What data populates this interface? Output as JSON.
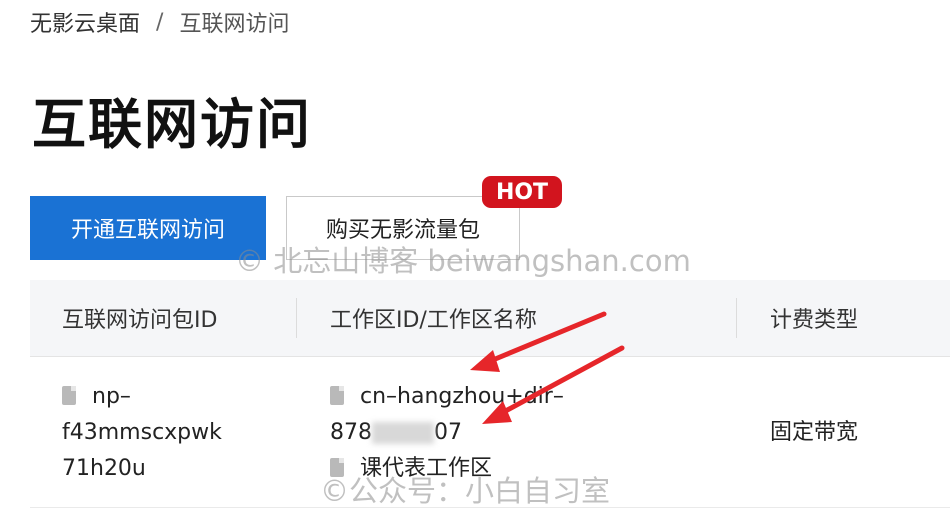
{
  "breadcrumb": {
    "root": "无影云桌面",
    "separator": "/",
    "current": "互联网访问"
  },
  "page": {
    "title": "互联网访问"
  },
  "actions": {
    "enable_label": "开通互联网访问",
    "buy_label": "购买无影流量包",
    "hot_badge": "HOT"
  },
  "table": {
    "headers": [
      "互联网访问包ID",
      "工作区ID/工作区名称",
      "计费类型"
    ],
    "rows": [
      {
        "package_id": "np-f43mmscxpwk71h20u",
        "package_id_lines": [
          "np–",
          "f43mmscxpwk",
          "71h20u"
        ],
        "workspace_id_line1": "cn–hangzhou+dir–",
        "workspace_id_line2_prefix": "878",
        "workspace_id_line2_suffix": "07",
        "workspace_name": "课代表工作区",
        "billing_type": "固定带宽"
      }
    ]
  },
  "watermarks": {
    "top": "© 北忘山博客 beiwangshan.com",
    "bottom": "©公众号：小白自习室"
  },
  "colors": {
    "primary": "#1a72d4",
    "hot": "#d2141e",
    "annotation_arrow": "#e6262a"
  },
  "icons": {
    "id_copy": "document-icon"
  }
}
